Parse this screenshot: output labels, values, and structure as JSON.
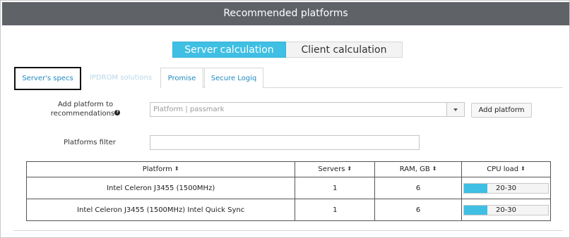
{
  "header": {
    "title": "Recommended platforms"
  },
  "calc_toggle": {
    "server_label": "Server calculation",
    "client_label": "Client calculation",
    "active": "server"
  },
  "tabs": [
    {
      "label": "Server's specs",
      "state": "active"
    },
    {
      "label": "IPDROM solutions",
      "state": "disabled"
    },
    {
      "label": "Promise",
      "state": "normal"
    },
    {
      "label": "Secure Logiq",
      "state": "normal"
    }
  ],
  "add_platform": {
    "label": "Add platform to recommendations",
    "help_icon": "question-circle-icon",
    "placeholder": "Platform | passmark",
    "button_label": "Add platform"
  },
  "filter": {
    "label": "Platforms filter",
    "value": ""
  },
  "table": {
    "headers": [
      "Platform",
      "Servers",
      "RAM, GB",
      "CPU load"
    ],
    "sort_icon": "sort-icon",
    "rows": [
      {
        "platform": "Intel Celeron J3455 (1500MHz)",
        "servers": "1",
        "ram": "6",
        "cpu_load": "20-30",
        "cpu_fill_fraction": 0.28
      },
      {
        "platform": "Intel Celeron J3455 (1500MHz) Intel Quick Sync",
        "servers": "1",
        "ram": "6",
        "cpu_load": "20-30",
        "cpu_fill_fraction": 0.28
      }
    ]
  },
  "colors": {
    "accent": "#3fbfe3",
    "header_bg": "#5f6368"
  }
}
